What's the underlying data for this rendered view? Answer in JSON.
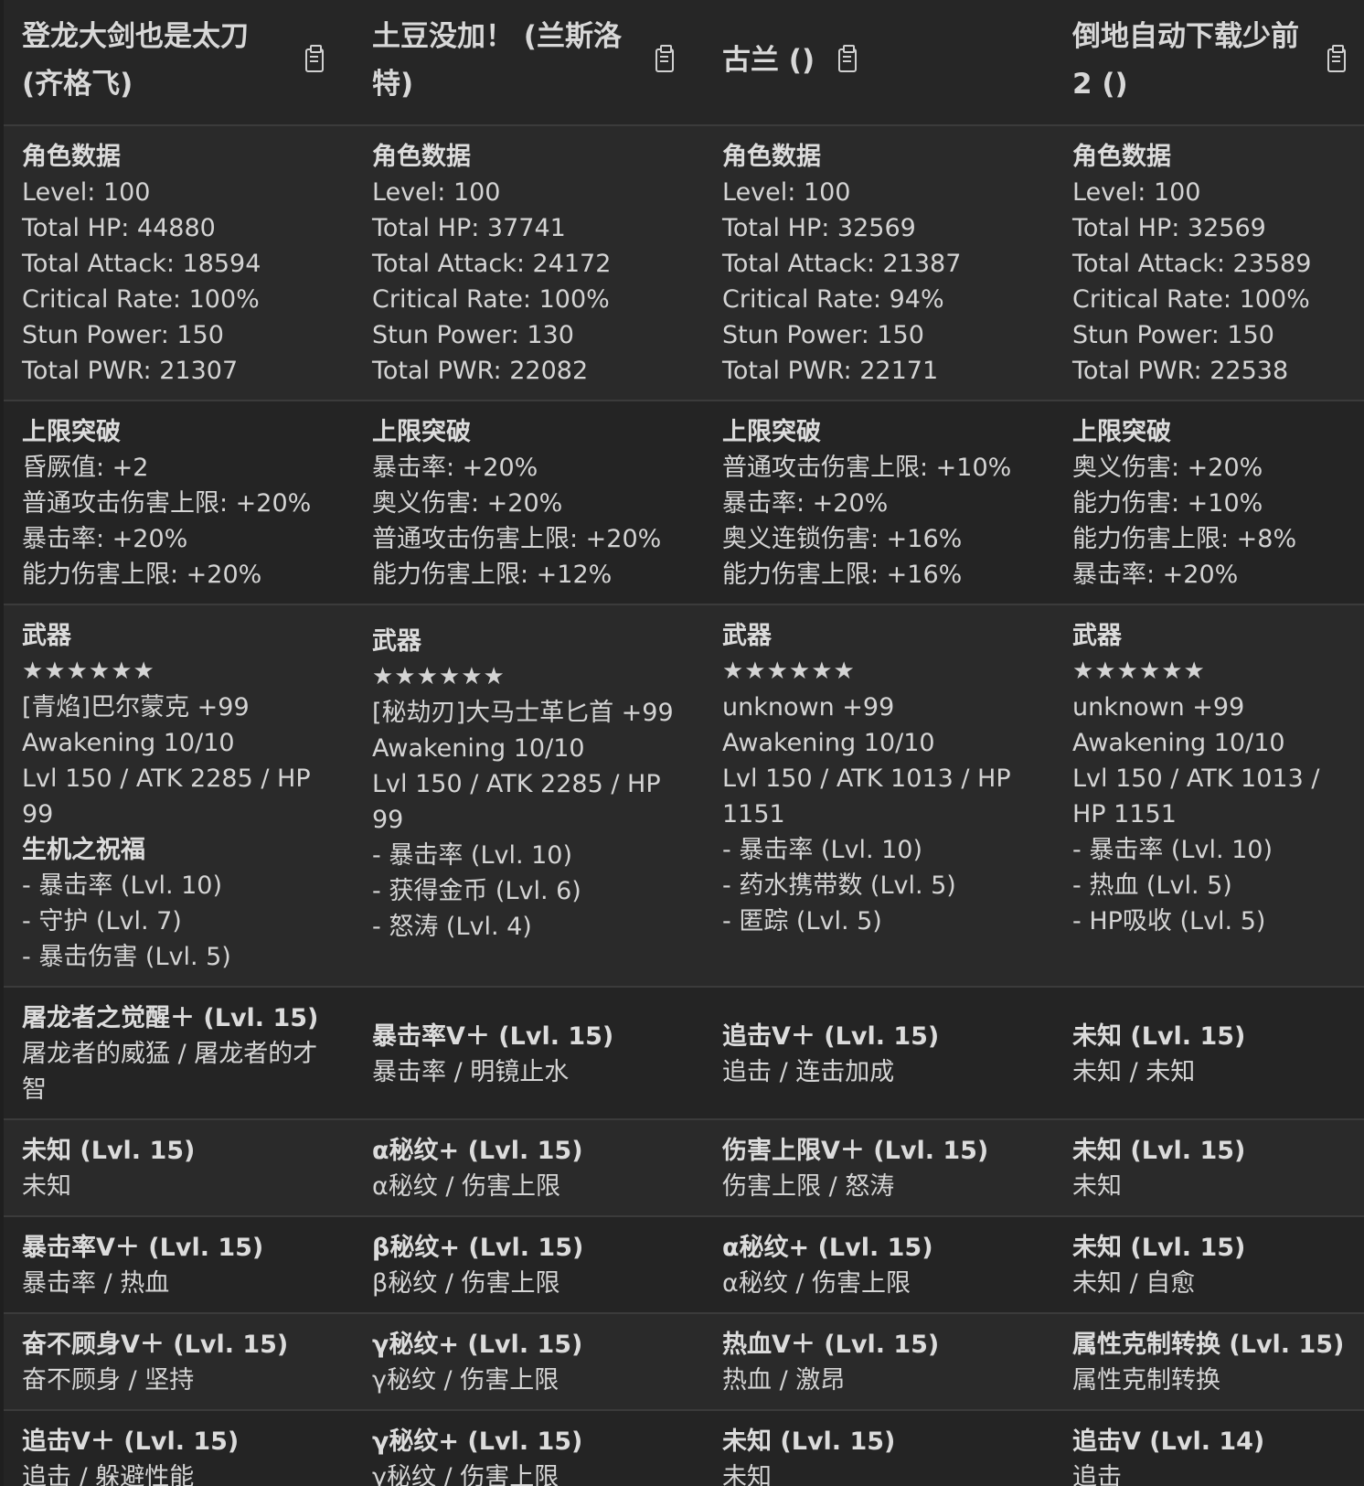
{
  "columns": [
    {
      "name": "登龙大剑也是太刀 (齐格飞)",
      "stats": {
        "label": "角色数据",
        "level": "Level: 100",
        "hp": "Total HP: 44880",
        "attack": "Total Attack: 18594",
        "crit": "Critical Rate: 100%",
        "stun": "Stun Power: 150",
        "pwr": "Total PWR: 21307"
      },
      "limit": {
        "label": "上限突破",
        "items": [
          "昏厥值: +2",
          "普通攻击伤害上限: +20%",
          "暴击率: +20%",
          "能力伤害上限: +20%"
        ]
      },
      "weapon": {
        "label": "武器",
        "stars": "★★★★★★",
        "name": "[青焰]巴尔蒙克 +99",
        "awakening": "Awakening 10/10",
        "stats": "Lvl 150 / ATK 2285 / HP 99",
        "extra_label": "生机之祝福",
        "skills": [
          "- 暴击率 (Lvl. 10)",
          "- 守护 (Lvl. 7)",
          "- 暴击伤害 (Lvl. 5)"
        ]
      },
      "summons": [
        {
          "title": "屠龙者之觉醒＋ (Lvl. 15)",
          "desc": "屠龙者的威猛 / 屠龙者的才智"
        },
        {
          "title": "未知 (Lvl. 15)",
          "desc": "未知"
        },
        {
          "title": "暴击率Ⅴ＋ (Lvl. 15)",
          "desc": "暴击率 / 热血"
        },
        {
          "title": "奋不顾身Ⅴ＋ (Lvl. 15)",
          "desc": "奋不顾身 / 坚持"
        },
        {
          "title": "追击Ⅴ＋ (Lvl. 15)",
          "desc": "追击 / 躲避性能"
        }
      ]
    },
    {
      "name": "土豆没加！ (兰斯洛特)",
      "stats": {
        "label": "角色数据",
        "level": "Level: 100",
        "hp": "Total HP: 37741",
        "attack": "Total Attack: 24172",
        "crit": "Critical Rate: 100%",
        "stun": "Stun Power: 130",
        "pwr": "Total PWR: 22082"
      },
      "limit": {
        "label": "上限突破",
        "items": [
          "暴击率: +20%",
          "奥义伤害: +20%",
          "普通攻击伤害上限: +20%",
          "能力伤害上限: +12%"
        ]
      },
      "weapon": {
        "label": "武器",
        "stars": "★★★★★★",
        "name": "[秘劫刃]大马士革匕首 +99",
        "awakening": "Awakening 10/10",
        "stats": "Lvl 150 / ATK 2285 / HP 99",
        "extra_label": "",
        "skills": [
          "- 暴击率 (Lvl. 10)",
          "- 获得金币 (Lvl. 6)",
          "- 怒涛 (Lvl. 4)"
        ]
      },
      "summons": [
        {
          "title": "暴击率Ⅴ＋ (Lvl. 15)",
          "desc": "暴击率 / 明镜止水"
        },
        {
          "title": "α秘纹+ (Lvl. 15)",
          "desc": "α秘纹 / 伤害上限"
        },
        {
          "title": "β秘纹+ (Lvl. 15)",
          "desc": "β秘纹 / 伤害上限"
        },
        {
          "title": "γ秘纹+ (Lvl. 15)",
          "desc": "γ秘纹 / 伤害上限"
        },
        {
          "title": "γ秘纹+ (Lvl. 15)",
          "desc": "γ秘纹 / 伤害上限"
        }
      ]
    },
    {
      "name": "古兰 ()",
      "stats": {
        "label": "角色数据",
        "level": "Level: 100",
        "hp": "Total HP: 32569",
        "attack": "Total Attack: 21387",
        "crit": "Critical Rate: 94%",
        "stun": "Stun Power: 150",
        "pwr": "Total PWR: 22171"
      },
      "limit": {
        "label": "上限突破",
        "items": [
          "普通攻击伤害上限: +10%",
          "暴击率: +20%",
          "奥义连锁伤害: +16%",
          "能力伤害上限: +16%"
        ]
      },
      "weapon": {
        "label": "武器",
        "stars": "★★★★★★",
        "name": "unknown +99",
        "awakening": "Awakening 10/10",
        "stats": "Lvl 150 / ATK 1013 / HP 1151",
        "extra_label": "",
        "skills": [
          "- 暴击率 (Lvl. 10)",
          "- 药水携带数 (Lvl. 5)",
          "- 匿踪 (Lvl. 5)"
        ]
      },
      "summons": [
        {
          "title": "追击Ⅴ＋ (Lvl. 15)",
          "desc": "追击 / 连击加成"
        },
        {
          "title": "伤害上限Ⅴ＋ (Lvl. 15)",
          "desc": "伤害上限 / 怒涛"
        },
        {
          "title": "α秘纹+ (Lvl. 15)",
          "desc": "α秘纹 / 伤害上限"
        },
        {
          "title": "热血Ⅴ＋ (Lvl. 15)",
          "desc": "热血 / 激昂"
        },
        {
          "title": "未知 (Lvl. 15)",
          "desc": "未知"
        }
      ]
    },
    {
      "name": "倒地自动下载少前2 ()",
      "stats": {
        "label": "角色数据",
        "level": "Level: 100",
        "hp": "Total HP: 32569",
        "attack": "Total Attack: 23589",
        "crit": "Critical Rate: 100%",
        "stun": "Stun Power: 150",
        "pwr": "Total PWR: 22538"
      },
      "limit": {
        "label": "上限突破",
        "items": [
          "奥义伤害: +20%",
          "能力伤害: +10%",
          "能力伤害上限: +8%",
          "暴击率: +20%"
        ]
      },
      "weapon": {
        "label": "武器",
        "stars": "★★★★★★",
        "name": "unknown +99",
        "awakening": "Awakening 10/10",
        "stats": "Lvl 150 / ATK 1013 / HP 1151",
        "extra_label": "",
        "skills": [
          "- 暴击率 (Lvl. 10)",
          "- 热血 (Lvl. 5)",
          "- HP吸收 (Lvl. 5)"
        ]
      },
      "summons": [
        {
          "title": "未知 (Lvl. 15)",
          "desc": "未知 / 未知"
        },
        {
          "title": "未知 (Lvl. 15)",
          "desc": "未知"
        },
        {
          "title": "未知 (Lvl. 15)",
          "desc": "未知 / 自愈"
        },
        {
          "title": "属性克制转换 (Lvl. 15)",
          "desc": "属性克制转换"
        },
        {
          "title": "追击Ⅴ (Lvl. 14)",
          "desc": "追击"
        }
      ]
    }
  ]
}
